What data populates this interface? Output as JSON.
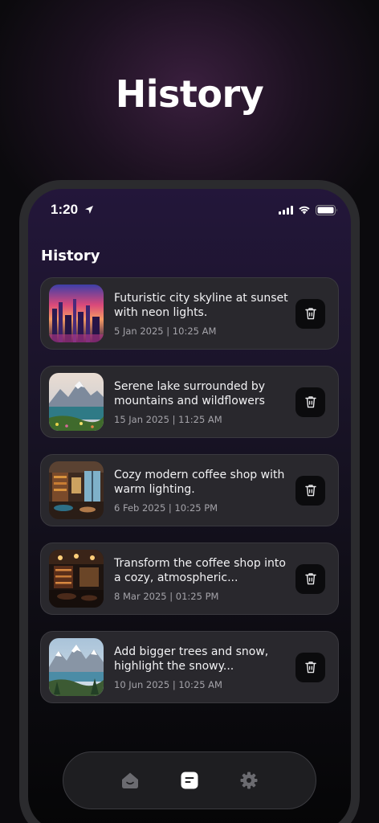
{
  "header": {
    "title": "History"
  },
  "status_bar": {
    "time": "1:20"
  },
  "screen": {
    "title": "History"
  },
  "history": [
    {
      "description": "Futuristic city skyline at sunset with neon lights.",
      "date": "5 Jan 2025 | 10:25 AM",
      "thumbnail": "city-skyline-image"
    },
    {
      "description": "Serene lake surrounded by mountains and wildflowers",
      "date": "15 Jan 2025 | 11:25 AM",
      "thumbnail": "mountain-lake-image"
    },
    {
      "description": "Cozy modern coffee shop with warm lighting.",
      "date": "6 Feb 2025 | 10:25 PM",
      "thumbnail": "coffee-shop-image"
    },
    {
      "description": "Transform the coffee shop into a cozy, atmospheric...",
      "date": "8 Mar 2025 | 01:25 PM",
      "thumbnail": "cozy-cafe-image"
    },
    {
      "description": "Add bigger trees and snow, highlight the snowy...",
      "date": "10 Jun 2025 | 10:25 AM",
      "thumbnail": "snowy-mountains-image"
    }
  ],
  "nav": {
    "items": [
      "home-icon",
      "history-icon",
      "settings-icon"
    ],
    "active": "history-icon"
  },
  "colors": {
    "card_bg": "#29282d",
    "screen_top": "#23163a",
    "nav_active": "#ffffff",
    "nav_inactive": "#6b6b70"
  }
}
